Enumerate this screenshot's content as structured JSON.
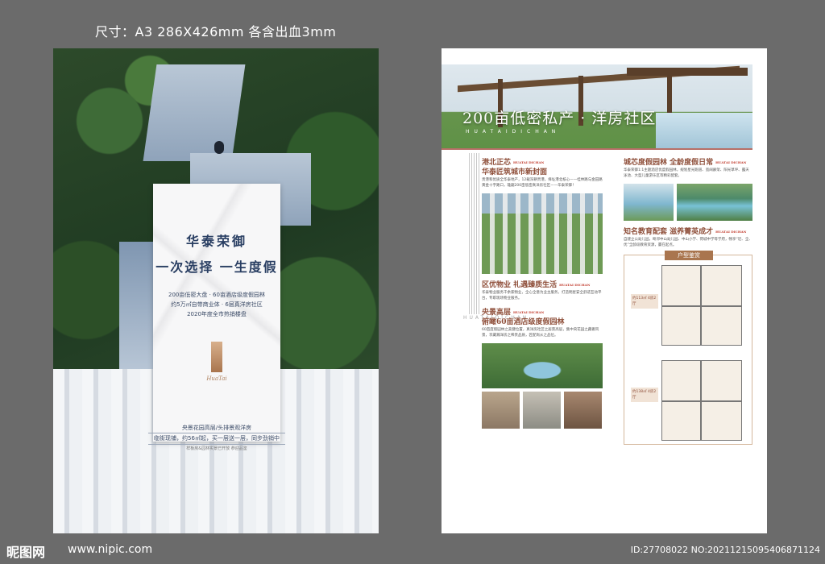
{
  "size_note": "尺寸：A3 286X426mm 各含出血3mm",
  "front": {
    "title": "华泰荣御",
    "slogan": "一次选择 一生度假",
    "tiny": "",
    "points": [
      "200亩低密大盘 · 60亩酒店级度假园林",
      "约5万㎡自带商业体 · 6层真洋房社区",
      "2020年度全市热销楼盘"
    ],
    "sign": "HuaTai",
    "footer_line1": "央景花园高层/头排景观洋房",
    "footer_line2": "临街现铺，约56㎡起，买一层送一层，同步劲销中",
    "footer_line3": "样板房&园林实景已开放 恭迎品鉴"
  },
  "back": {
    "hero_title": "200亩低密私产 · 洋房社区",
    "hero_sub": "HUATAIDICHAN",
    "vertical_text": "HUATAIDICHAN",
    "left": {
      "sec1_title1": "港北正芯",
      "sec1_title2": "华泰匠筑城市新封面",
      "sec1_tag": "HUATAI DICHAN",
      "sec1_body": "贵港和优质全华泰地产，12载深耕贵港，择址港北核心——桂林路与金田路黄金十字路口，雄踞200亩低密真洋房社区——华泰荣御！",
      "sec2_title": "区优物业 礼遇臻质生活",
      "sec2_tag": "HUATAI DICHAN",
      "sec2_body": "华泰物业服务千余家物业，全心全意为业主服务，打造明星安全舒适互动平台，专职现场物业服务。",
      "sec3_title1": "央景高层",
      "sec3_title2": "俯瞰60亩酒店级度假园林",
      "sec3_tag": "HUATAI DICHAN",
      "sec3_body": "60亩度假园林之美健位置，真洋房社区之居景高层，集中央花园之藏奢风景，享藏瀚洋房之稀贵品质，匠配尚从之品位。"
    },
    "right": {
      "sec1_title": "城芯度假园林 全龄度假日常",
      "sec1_tag": "HUATAI DICHAN",
      "sec1_body": "华泰荣御1:1主题酒店优度假园林，规划星光跑道、宽阔廊架、阳光草坪、露天泳池、大型儿童游乐区等精彩配套。",
      "sec2_title": "知名教育配套 滋养菁英成才",
      "sec2_tag": "HUATAI DICHAN",
      "sec2_body": "自建立公幼儿园，毗邻中山幼儿园、中山小学、荷城中学等学府，畅享“近、全、优”全龄段教育资源，赢在起点。",
      "plans_title": "户型鉴赏",
      "plan_a_label": "约113㎡ 4房2厅",
      "plan_b_label": "约138㎡ 4房2厅"
    }
  },
  "watermark": {
    "logo": "昵图网",
    "url": "www.nipic.com",
    "id": "ID:27708022 NO:20211215095406871124"
  }
}
